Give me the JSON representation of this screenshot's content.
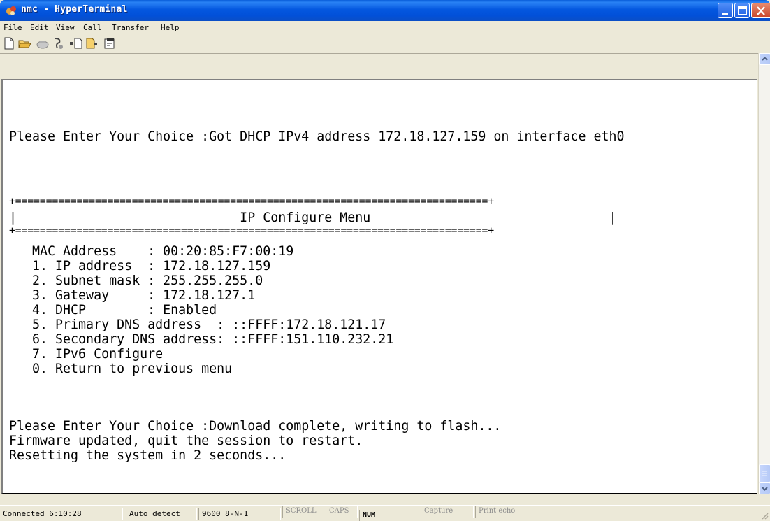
{
  "window": {
    "title": "nmc - HyperTerminal",
    "accent": "#0458E0"
  },
  "menu": {
    "items": [
      {
        "key": "F",
        "rest": "ile"
      },
      {
        "key": "E",
        "rest": "dit"
      },
      {
        "key": "V",
        "rest": "iew"
      },
      {
        "key": "C",
        "rest": "all"
      },
      {
        "key": "T",
        "rest": "ransfer"
      },
      {
        "key": "H",
        "rest": "elp"
      }
    ]
  },
  "toolbar": {
    "icons": [
      "new-connection-icon",
      "open-icon",
      "disconnect-icon",
      "dial-icon",
      "send-file-icon",
      "receive-file-icon",
      "properties-icon"
    ]
  },
  "terminal": {
    "lines": [
      "Please Enter Your Choice :Got DHCP IPv4 address 172.18.127.159 on interface eth0",
      "+=============================================================================+",
      "|                             IP Configure Menu                               |",
      "+=============================================================================+",
      "   MAC Address    : 00:20:85:F7:00:19",
      "   1. IP address  : 172.18.127.159",
      "   2. Subnet mask : 255.255.255.0",
      "   3. Gateway     : 172.18.127.1",
      "   4. DHCP        : Enabled",
      "   5. Primary DNS address  : ::FFFF:172.18.121.17",
      "   6. Secondary DNS address: ::FFFF:151.110.232.21",
      "   7. IPv6 Configure",
      "   0. Return to previous menu",
      "Please Enter Your Choice :Download complete, writing to flash...",
      "Firmware updated, quit the session to restart.",
      "Resetting the system in 2 seconds..."
    ]
  },
  "status": {
    "connected": "Connected 6:10:28",
    "detect": "Auto detect",
    "settings": "9600 8-N-1",
    "scroll": "SCROLL",
    "caps": "CAPS",
    "num": "NUM",
    "capture": "Capture",
    "print_echo": "Print echo"
  }
}
